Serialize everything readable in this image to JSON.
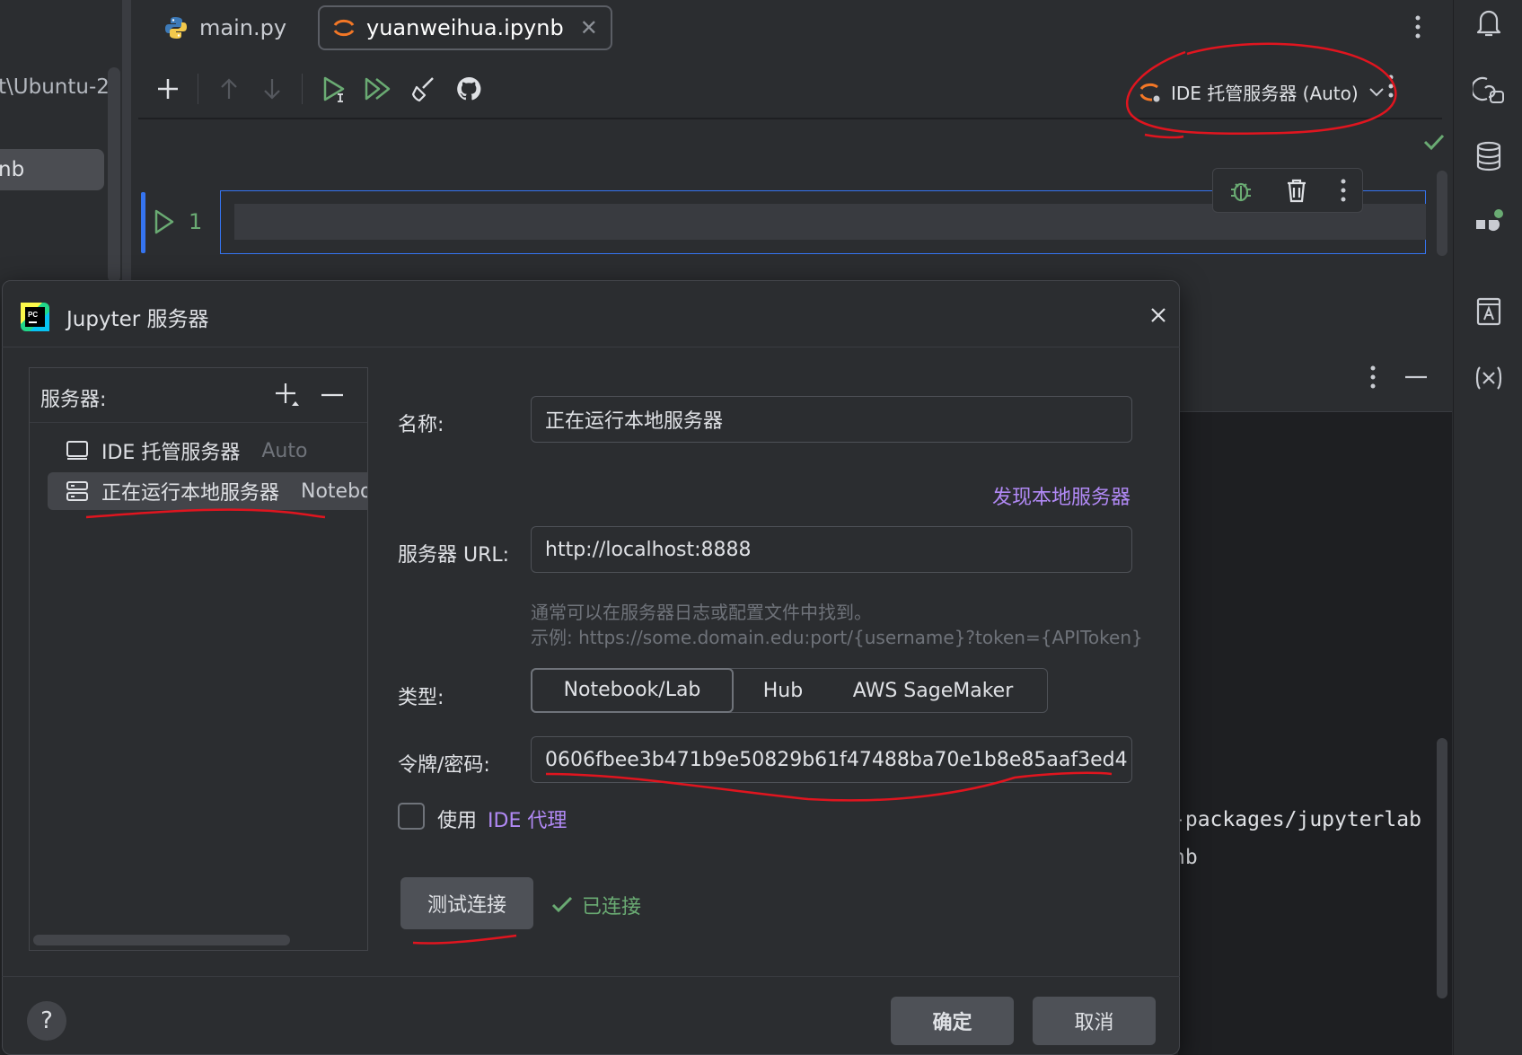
{
  "background": {
    "left_path": "t\\Ubuntu-2",
    "left_selected": "nb"
  },
  "tabs": [
    {
      "label": "main.py",
      "icon": "python-file-icon",
      "active": false
    },
    {
      "label": "yuanweihua.ipynb",
      "icon": "jupyter-file-icon",
      "active": true
    }
  ],
  "toolbar": {
    "server_label": "IDE 托管服务器 (Auto)"
  },
  "cell": {
    "number": "1"
  },
  "console": {
    "lines": [
      "-packages/jupyterlab",
      "nb"
    ]
  },
  "dialog": {
    "title": "Jupyter 服务器",
    "server_list": {
      "header": "服务器:",
      "items": [
        {
          "name": "IDE 托管服务器",
          "type": "Auto",
          "icon": "monitor-icon",
          "selected": false
        },
        {
          "name": "正在运行本地服务器",
          "type": "Notebook",
          "icon": "server-icon",
          "selected": true
        }
      ]
    },
    "form": {
      "name_label": "名称:",
      "name_value": "正在运行本地服务器",
      "discover_link": "发现本地服务器",
      "url_label": "服务器 URL:",
      "url_value": "http://localhost:8888",
      "hint_line1": "通常可以在服务器日志或配置文件中找到。",
      "hint_line2": "示例: https://some.domain.edu:port/{username}?token={APIToken}",
      "type_label": "类型:",
      "type_options": [
        "Notebook/Lab",
        "Hub",
        "AWS SageMaker"
      ],
      "type_selected": "Notebook/Lab",
      "token_label": "令牌/密码:",
      "token_value": "0606fbee3b471b9e50829b61f47488ba70e1b8e85aaf3ed4",
      "use_label": "使用",
      "proxy_link": "IDE 代理",
      "proxy_checked": false,
      "test_button": "测试连接",
      "status": "已连接"
    },
    "help": "?",
    "ok_button": "确定",
    "cancel_button": "取消"
  },
  "colors": {
    "accent": "#3574f0",
    "success": "#6aab73",
    "link": "#b189f5",
    "annotation": "#e0151f"
  }
}
